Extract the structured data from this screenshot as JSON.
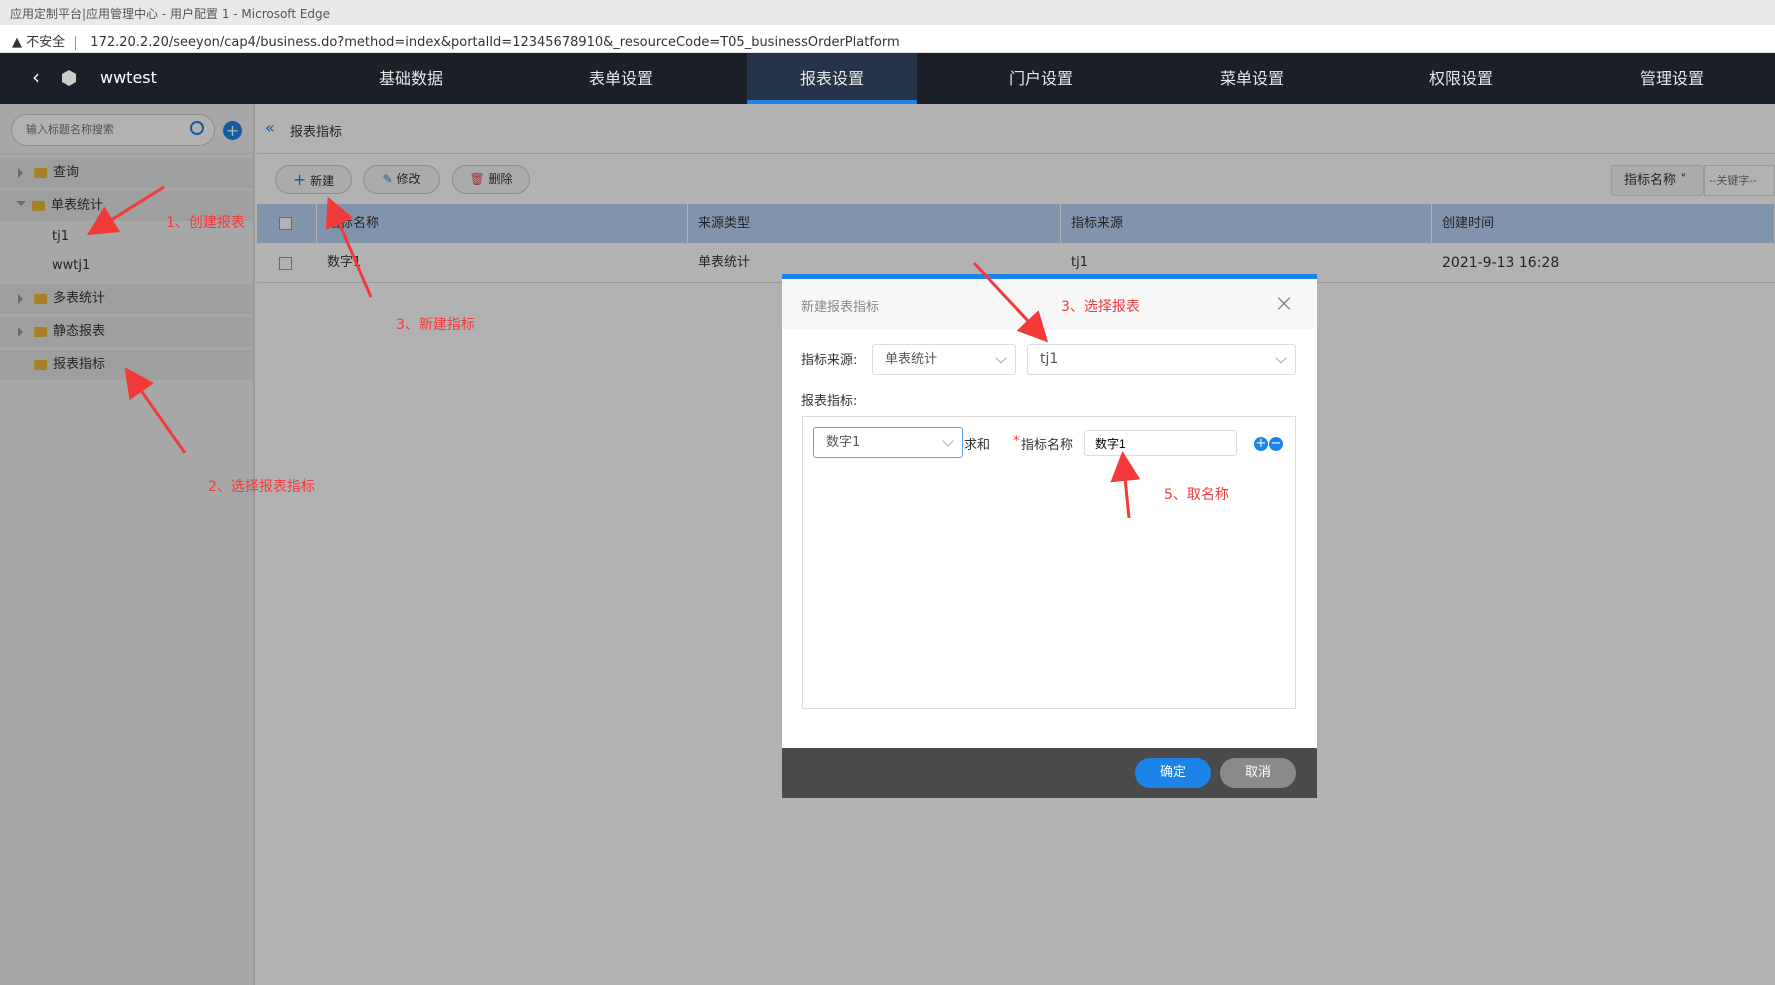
{
  "browser": {
    "title": "应用定制平台|应用管理中心 - 用户配置 1 - Microsoft Edge",
    "security": "不安全",
    "url": "172.20.2.20/seeyon/cap4/business.do?method=index&portalId=12345678910&_resourceCode=T05_businessOrderPlatform"
  },
  "nav": {
    "app_name": "wwtest",
    "items": [
      "基础数据",
      "表单设置",
      "报表设置",
      "门户设置",
      "菜单设置",
      "权限设置",
      "管理设置"
    ],
    "active": "报表设置"
  },
  "sidebar": {
    "search_placeholder": "输入标题名称搜索",
    "items": [
      {
        "label": "查询"
      },
      {
        "label": "单表统计"
      },
      {
        "label": "tj1"
      },
      {
        "label": "wwtj1"
      },
      {
        "label": "多表统计"
      },
      {
        "label": "静态报表"
      },
      {
        "label": "报表指标"
      }
    ]
  },
  "main": {
    "breadcrumb": "报表指标",
    "toolbar": {
      "new": "新建",
      "edit": "修改",
      "delete": "删除",
      "search_field": "指标名称",
      "keyword_placeholder": "--关键字--"
    },
    "columns": [
      "指标名称",
      "来源类型",
      "指标来源",
      "创建时间"
    ],
    "rows": [
      {
        "name": "数字1",
        "type": "单表统计",
        "source": "tj1",
        "time": "2021-9-13 16:28"
      }
    ]
  },
  "dialog": {
    "title": "新建报表指标",
    "source_label": "指标来源:",
    "source_type": "单表统计",
    "source_report": "tj1",
    "metrics_label": "报表指标:",
    "field": "数字1",
    "agg": "求和",
    "name_label": "指标名称",
    "required_mark": "*",
    "name_value": "数字1",
    "ok": "确定",
    "cancel": "取消"
  },
  "annotations": [
    "1、创建报表",
    "2、选择报表指标",
    "3、新建指标",
    "3、选择报表",
    "5、取名称"
  ],
  "colors": {
    "accent": "#1c83e8",
    "annotation": "#f23a3a",
    "nav_bg": "#1b1f27"
  }
}
